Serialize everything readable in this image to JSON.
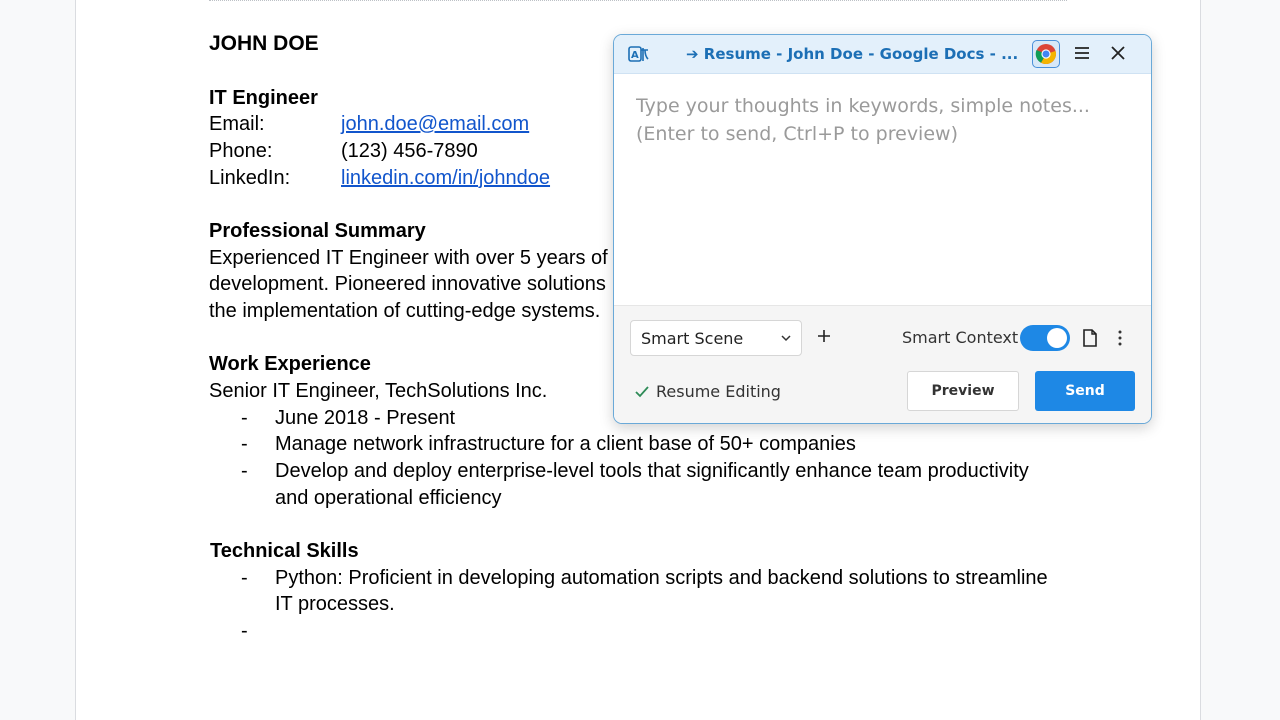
{
  "document": {
    "name": "JOHN DOE",
    "role": "IT Engineer",
    "contact": [
      {
        "label": "Email:",
        "value": "john.doe@email.com",
        "link": true
      },
      {
        "label": "Phone:",
        "value": "(123) 456-7890",
        "link": false
      },
      {
        "label": "LinkedIn:",
        "value": "linkedin.com/in/johndoe",
        "link": true
      }
    ],
    "summary_heading": "Professional Summary",
    "summary_lines": [
      "Experienced IT Engineer with over 5 years of",
      "development. Pioneered innovative solutions",
      "the implementation of cutting-edge systems."
    ],
    "work_heading": "Work Experience",
    "work_title": "Senior IT Engineer, TechSolutions Inc.",
    "work_bullets": [
      "June 2018 - Present",
      "Manage network infrastructure for a client base of 50+ companies",
      "Develop and deploy enterprise-level tools that significantly enhance team productivity",
      "and operational efficiency"
    ],
    "skills_heading": "Technical Skills",
    "skills_bullets": [
      "Python: Proficient in developing automation scripts and backend solutions to streamline",
      "IT processes.",
      ""
    ],
    "bullet_dash": "-"
  },
  "panel": {
    "title": "➔ Resume - John Doe - Google Docs - ...",
    "input_placeholder": "Type your thoughts in keywords, simple notes...\n(Enter to send, Ctrl+P to preview)",
    "scene_select": "Smart Scene",
    "smart_context_label": "Smart Context",
    "smart_context_on": true,
    "status_label": "Resume Editing",
    "preview_label": "Preview",
    "send_label": "Send",
    "accent_color": "#1e88e5",
    "header_color": "#e3f0fb"
  },
  "icons": {
    "app_logo": "translate-ai-icon",
    "browser": "chrome-icon",
    "menu": "hamburger-menu-icon",
    "close": "close-icon",
    "dropdown": "chevron-down-icon",
    "add": "plus-icon",
    "document": "document-icon",
    "more": "more-vertical-icon",
    "status": "check-icon"
  }
}
